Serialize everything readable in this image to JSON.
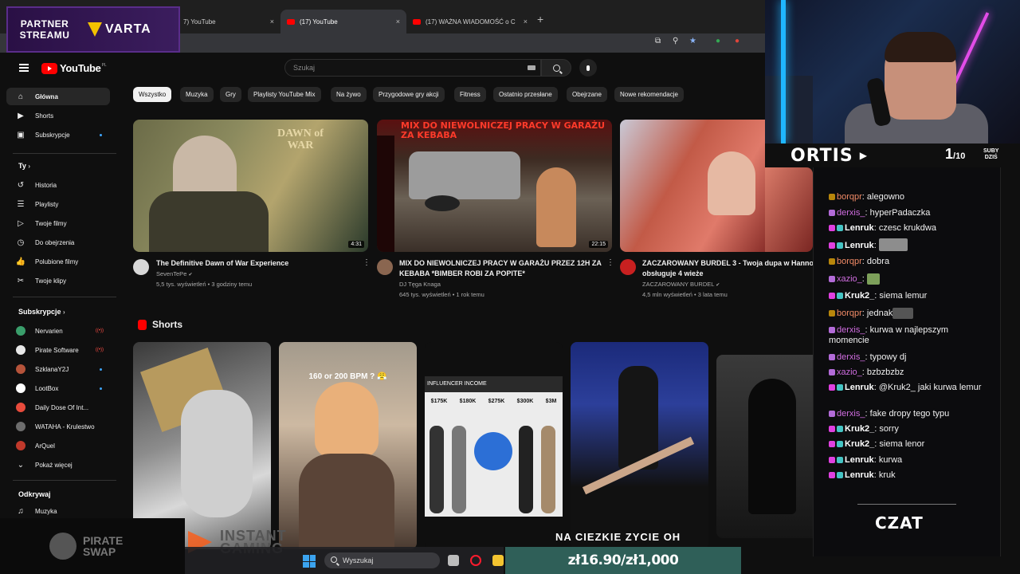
{
  "browser": {
    "tabs": [
      {
        "label": "7) YouTube",
        "active": false
      },
      {
        "label": "(17) YouTube",
        "active": true
      },
      {
        "label": "(17) WAŻNA WIADOMOŚĆ o C",
        "active": false
      }
    ],
    "close_glyph": "×",
    "new_tab_glyph": "+"
  },
  "sponsor": {
    "label_line1": "PARTNER",
    "label_line2": "STREAMU",
    "brand": "VARTA"
  },
  "header": {
    "logo_text": "YouTube",
    "country_code": "PL",
    "search_placeholder": "Szukaj"
  },
  "sidebar": {
    "main": [
      {
        "label": "Główna",
        "icon": "home-icon",
        "glyph": "⌂",
        "active": true
      },
      {
        "label": "Shorts",
        "icon": "shorts-icon",
        "glyph": "▶",
        "active": false
      },
      {
        "label": "Subskrypcje",
        "icon": "subscriptions-icon",
        "glyph": "▣",
        "active": false
      }
    ],
    "you_heading": "Ty",
    "you": [
      {
        "label": "Historia",
        "icon": "history-icon",
        "glyph": "↺"
      },
      {
        "label": "Playlisty",
        "icon": "playlists-icon",
        "glyph": "☰"
      },
      {
        "label": "Twoje filmy",
        "icon": "your-videos-icon",
        "glyph": "▷"
      },
      {
        "label": "Do obejrzenia",
        "icon": "watch-later-icon",
        "glyph": "◷"
      },
      {
        "label": "Polubione filmy",
        "icon": "liked-icon",
        "glyph": "👍"
      },
      {
        "label": "Twoje klipy",
        "icon": "clips-icon",
        "glyph": "✂"
      }
    ],
    "subs_heading": "Subskrypcje",
    "subs": [
      {
        "label": "Nervarien",
        "color": "#3a9e6b",
        "live": true
      },
      {
        "label": "Pirate Software",
        "color": "#e8e8e8",
        "live": true
      },
      {
        "label": "SzklanaY2J",
        "color": "#b5533a",
        "live": false
      },
      {
        "label": "LootBox",
        "color": "#ffffff",
        "live": false
      },
      {
        "label": "Daily Dose Of Int...",
        "color": "#e84b3c",
        "live": false
      },
      {
        "label": "WATAHA - Krulestwo",
        "color": "#6d6d6d",
        "live": false
      },
      {
        "label": "ArQuel",
        "color": "#c0392b",
        "live": false
      }
    ],
    "show_more": "Pokaż więcej",
    "explore_heading": "Odkrywaj",
    "explore": [
      {
        "label": "Muzyka",
        "icon": "music-icon",
        "glyph": "♫"
      }
    ]
  },
  "chips": [
    "Wszystko",
    "Muzyka",
    "Gry",
    "Playlisty YouTube Mix",
    "Na żywo",
    "Przygodowe gry akcji",
    "Fitness",
    "Ostatnio przesłane",
    "Obejrzane",
    "Nowe rekomendacje"
  ],
  "videos": [
    {
      "title_line1": "The Definitive Dawn of War Experience",
      "title_line2": "",
      "channel": "SevenTePe",
      "meta": "5,5 tys. wyświetleń • 3 godziny temu",
      "duration": "4:31",
      "thumb_title": "DAWN of WAR"
    },
    {
      "title_line1": "MIX DO NIEWOLNICZEJ PRACY W GARAŻU PRZEZ 12H ZA",
      "title_line2": "KEBABA *BIMBER ROBI ZA POPITE*",
      "channel": "DJ Tęga Knaga",
      "meta": "645 tys. wyświetleń • 1 rok temu",
      "duration": "22:15",
      "thumb_title": "MIX DO NIEWOLNICZEJ PRACY W GARAŻU ZA KEBABA"
    },
    {
      "title_line1": "ZACZAROWANY BURDEL 3 - Twoja dupa w Hanno",
      "title_line2": "obsługuje 4 wieże",
      "channel": "ZACZAROWANY BURDEL",
      "meta": "4,5 mln wyświetleń • 3 lata temu",
      "duration": "",
      "thumb_title": ""
    }
  ],
  "shorts": {
    "heading": "Shorts",
    "items": [
      {
        "caption": ""
      },
      {
        "caption": "160 or 200 BPM ? 😤"
      },
      {
        "caption": "INFLUENCER INCOME",
        "prices": [
          "$175K",
          "$180K",
          "$275K",
          "$300K",
          "$3M"
        ]
      },
      {
        "caption": ""
      },
      {
        "caption": ""
      }
    ]
  },
  "stream": {
    "streamer": "ORTIS",
    "subs_current": "1",
    "subs_goal": "/10",
    "subs_label_line1": "SUBY",
    "subs_label_line2": "DZIŚ",
    "chat_title": "CZAT",
    "chat": [
      {
        "user": "borqpr",
        "color": "#f08a66",
        "msg": "alegowno",
        "emote": ""
      },
      {
        "user": "derxis_",
        "color": "#d06de0",
        "msg": "hyperPadaczka",
        "emote": ""
      },
      {
        "user": "Lenruk",
        "color": "#ffffff",
        "msg": "czesc krukdwa",
        "emote": ""
      },
      {
        "user": "Lenruk",
        "color": "#ffffff",
        "msg": "",
        "emote": "face"
      },
      {
        "user": "borqpr",
        "color": "#f08a66",
        "msg": "dobra",
        "emote": ""
      },
      {
        "user": "xazio_",
        "color": "#d06de0",
        "msg": "",
        "emote": "small"
      },
      {
        "user": "Kruk2_",
        "color": "#ffffff",
        "msg": "siema lemur",
        "emote": ""
      },
      {
        "user": "borqpr",
        "color": "#f08a66",
        "msg": "jednak",
        "emote": "dark"
      },
      {
        "user": "derxis_",
        "color": "#d06de0",
        "msg": "kurwa w najlepszym momencie",
        "emote": ""
      },
      {
        "user": "derxis_",
        "color": "#d06de0",
        "msg": "typowy dj",
        "emote": ""
      },
      {
        "user": "xazio_",
        "color": "#d06de0",
        "msg": "bzbzbzbz",
        "emote": ""
      },
      {
        "user": "Lenruk",
        "color": "#ffffff",
        "msg": "@Kruk2_ jaki kurwa lemur",
        "emote": ""
      },
      {
        "user": "derxis_",
        "color": "#d06de0",
        "msg": "fake dropy tego typu",
        "emote": ""
      },
      {
        "user": "Kruk2_",
        "color": "#ffffff",
        "msg": "sorry",
        "emote": ""
      },
      {
        "user": "Kruk2_",
        "color": "#ffffff",
        "msg": "siema lenor",
        "emote": ""
      },
      {
        "user": "Lenruk",
        "color": "#ffffff",
        "msg": "kurwa",
        "emote": ""
      },
      {
        "user": "Lenruk",
        "color": "#ffffff",
        "msg": "kruk",
        "emote": ""
      }
    ],
    "song": "NA CIEZKIE ZYCIE OH",
    "donation": "zł16.90/zł1,000",
    "sponsor_bottom": "PIRATE SWAP",
    "sponsor_bottom2": "INSTANT GAMING"
  },
  "taskbar": {
    "search_placeholder": "Wyszukaj"
  },
  "colors": {
    "yt_red": "#ff0000",
    "bg": "#0f0f0f",
    "accent": "#3ea6ff"
  }
}
